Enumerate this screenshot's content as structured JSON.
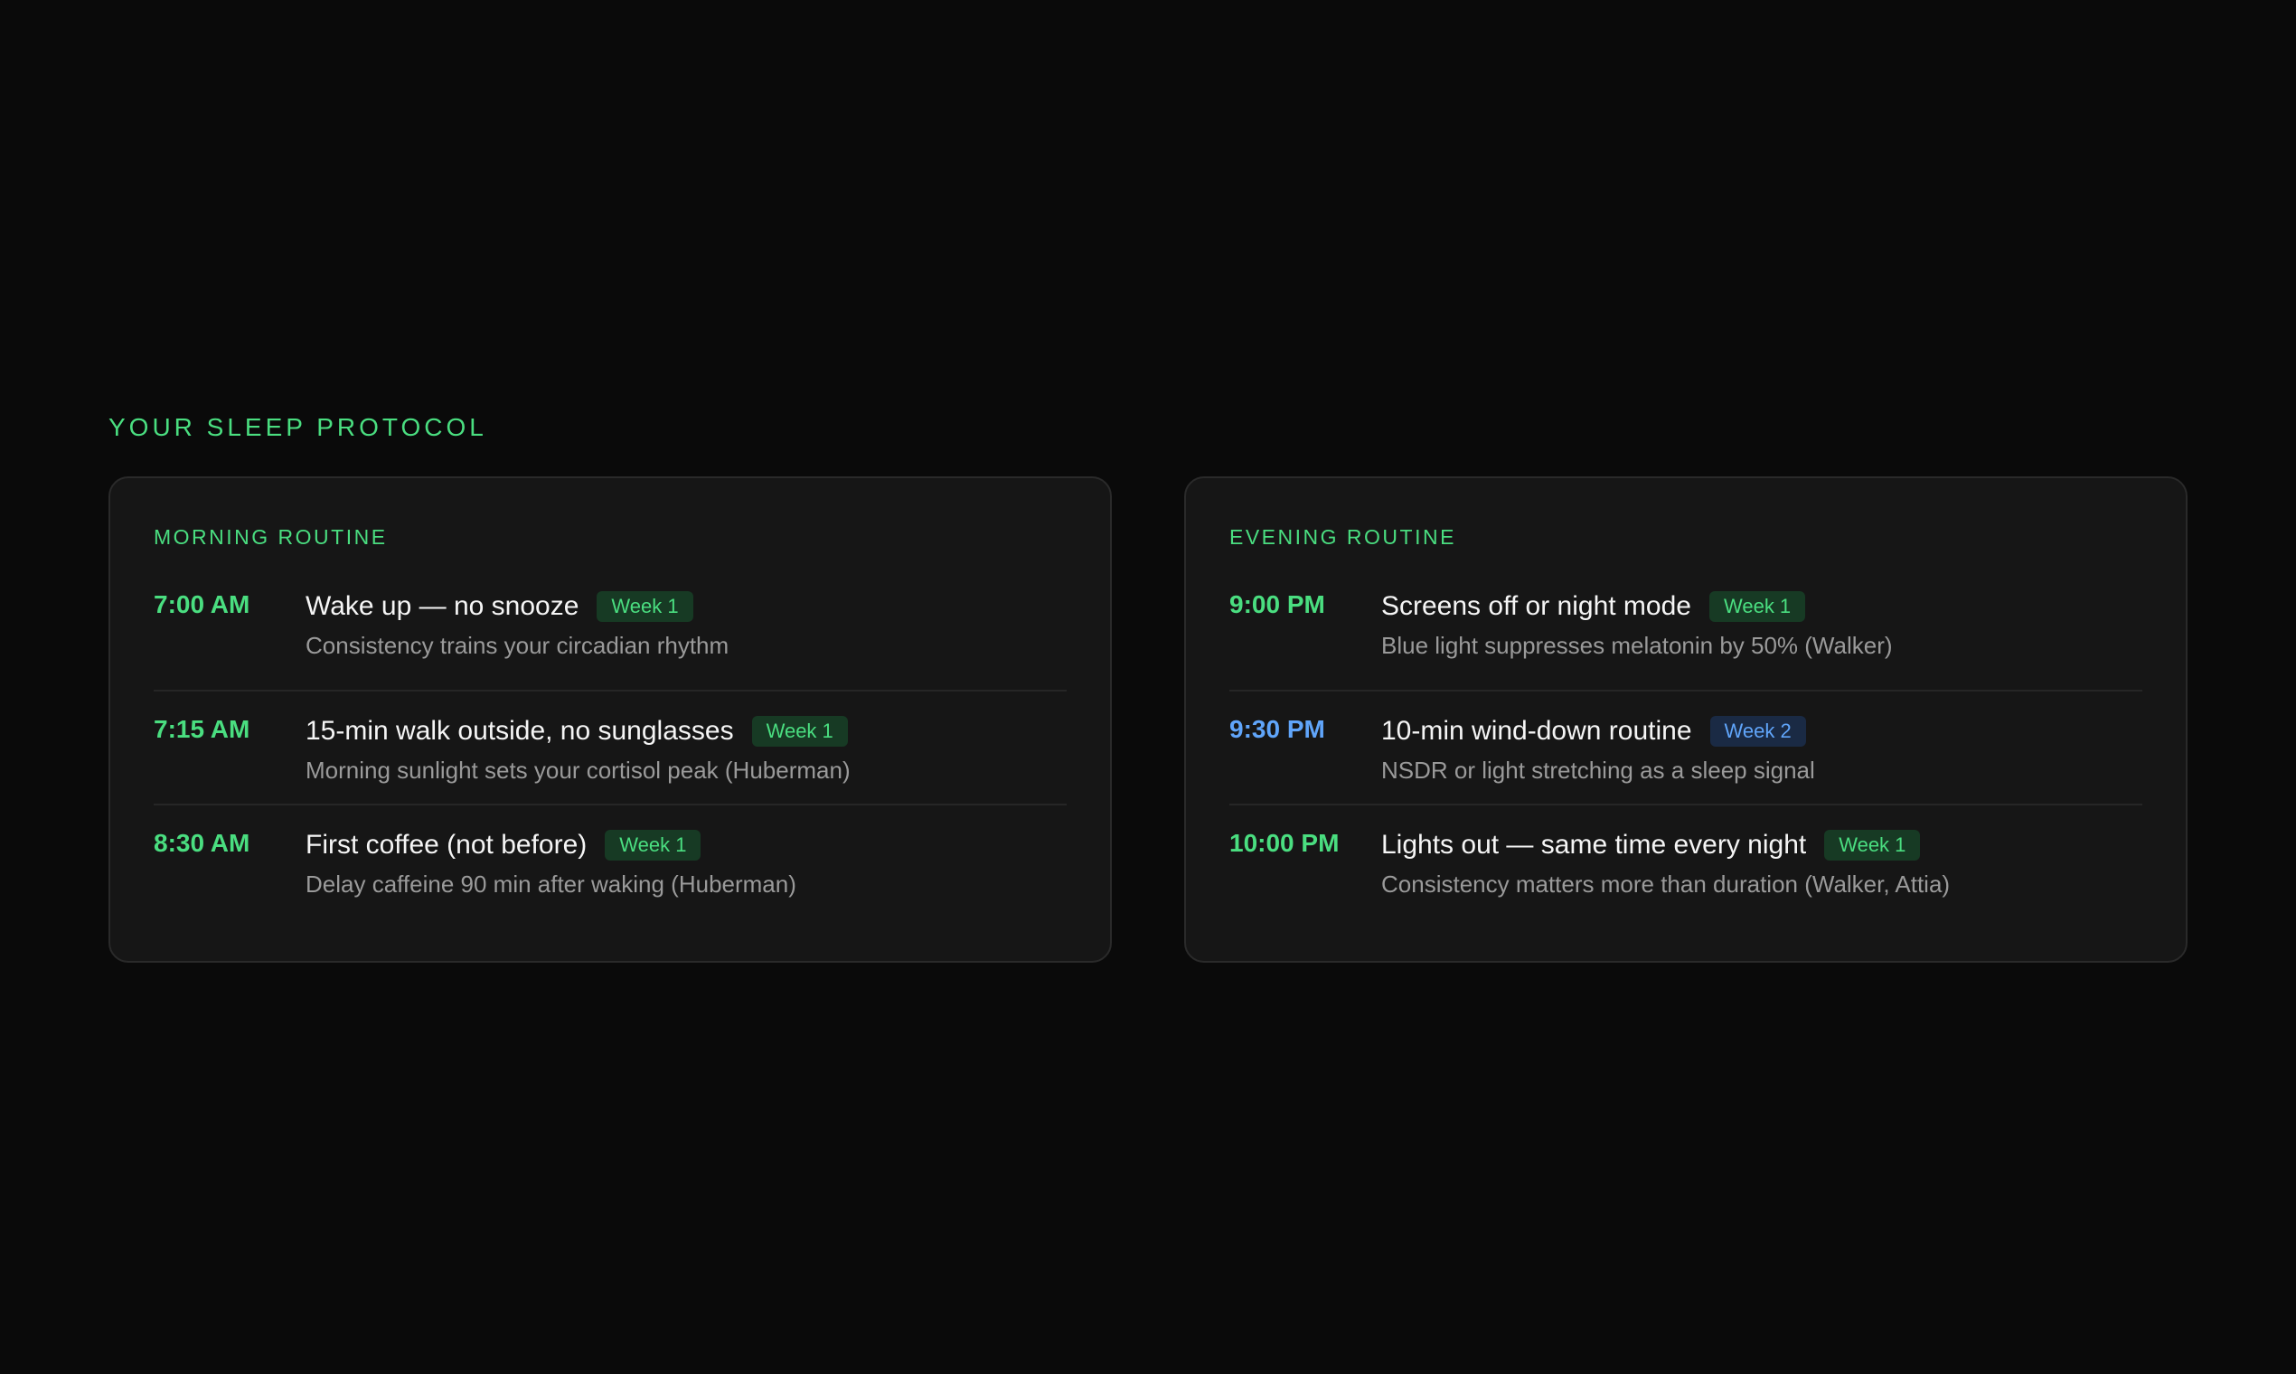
{
  "protocol": {
    "title": "YOUR SLEEP PROTOCOL"
  },
  "colors": {
    "accent_green": "#4ade80",
    "accent_blue": "#60a5fa",
    "background": "#0a0a0a",
    "card_background": "#161616"
  },
  "morning": {
    "title": "MORNING ROUTINE",
    "items": [
      {
        "time": "7:00 AM",
        "title": "Wake up — no snooze",
        "badge": "Week 1",
        "desc": "Consistency trains your circadian rhythm"
      },
      {
        "time": "7:15 AM",
        "title": "15-min walk outside, no sunglasses",
        "badge": "Week 1",
        "desc": "Morning sunlight sets your cortisol peak (Huberman)"
      },
      {
        "time": "8:30 AM",
        "title": "First coffee (not before)",
        "badge": "Week 1",
        "desc": "Delay caffeine 90 min after waking (Huberman)"
      }
    ]
  },
  "evening": {
    "title": "EVENING ROUTINE",
    "items": [
      {
        "time": "9:00 PM",
        "title": "Screens off or night mode",
        "badge": "Week 1",
        "desc": "Blue light suppresses melatonin by 50% (Walker)"
      },
      {
        "time": "9:30 PM",
        "title": "10-min wind-down routine",
        "badge": "Week 2",
        "desc": "NSDR or light stretching as a sleep signal"
      },
      {
        "time": "10:00 PM",
        "title": "Lights out — same time every night",
        "badge": "Week 1",
        "desc": "Consistency matters more than duration (Walker, Attia)"
      }
    ]
  }
}
